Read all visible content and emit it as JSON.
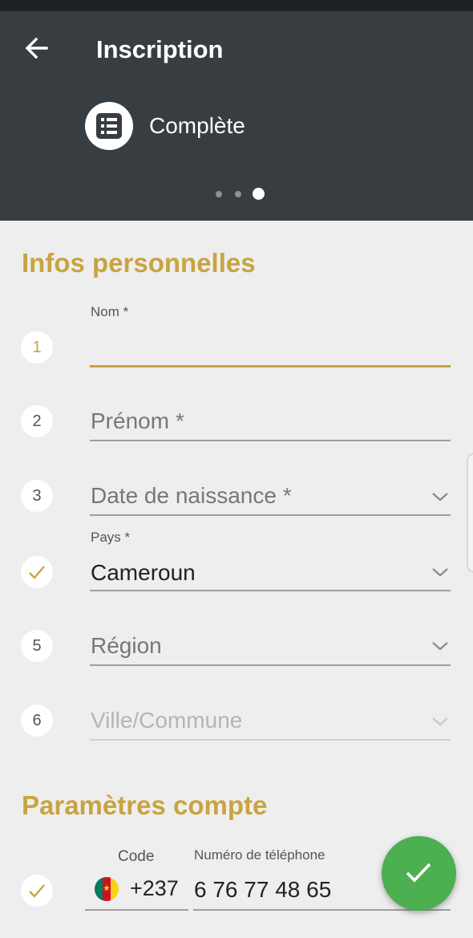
{
  "header": {
    "title": "Inscription",
    "step_label": "Complète",
    "back_icon": "arrow-left-icon",
    "step_icon": "list-icon",
    "pager": {
      "total": 3,
      "current": 3
    }
  },
  "sections": {
    "personal_title": "Infos personnelles",
    "account_title": "Paramètres compte"
  },
  "fields": {
    "nom": {
      "step": "1",
      "label": "Nom *",
      "value": ""
    },
    "prenom": {
      "step": "2",
      "placeholder": "Prénom *"
    },
    "date_naissance": {
      "step": "3",
      "placeholder": "Date de naissance *"
    },
    "pays": {
      "label": "Pays *",
      "value": "Cameroun",
      "status_icon": "check-icon"
    },
    "region": {
      "step": "5",
      "placeholder": "Région"
    },
    "ville": {
      "step": "6",
      "placeholder": "Ville/Commune"
    },
    "phone": {
      "code_label": "Code",
      "code_value": "+237",
      "number_label": "Numéro de téléphone",
      "number_value": "6 76 77 48 65",
      "flag_icon": "cameroon-flag-icon",
      "status_icon": "check-icon"
    }
  },
  "colors": {
    "accent": "#c8a43f",
    "appbar": "#383d42",
    "fab": "#4caf50",
    "background": "#eeeeee"
  },
  "fab": {
    "icon": "check-icon"
  }
}
